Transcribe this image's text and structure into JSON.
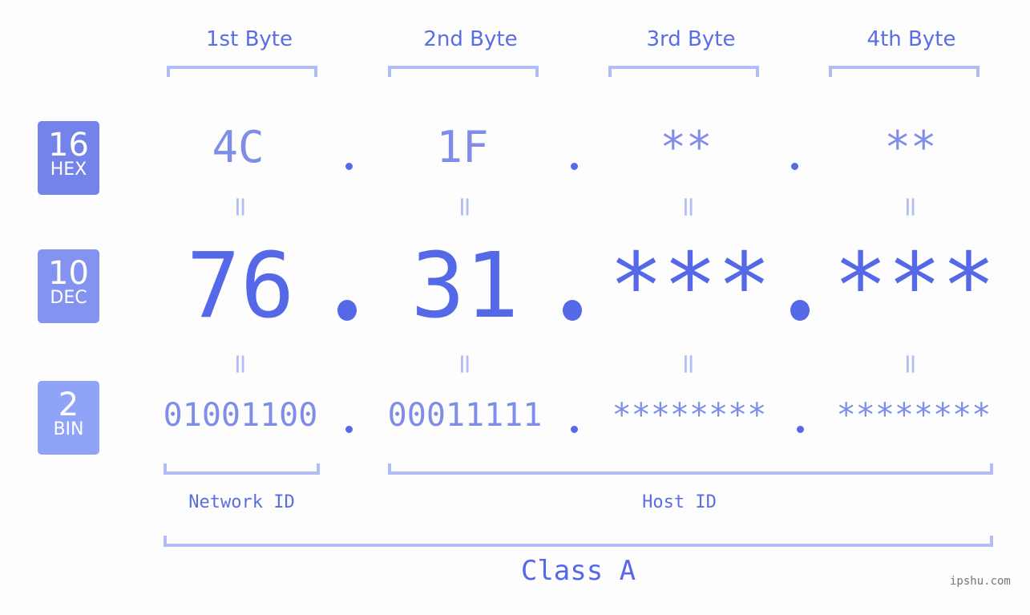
{
  "bytes": [
    {
      "label": "1st Byte",
      "hex": "4C",
      "dec": "76",
      "bin": "01001100"
    },
    {
      "label": "2nd Byte",
      "hex": "1F",
      "dec": "31",
      "bin": "00011111"
    },
    {
      "label": "3rd Byte",
      "hex": "**",
      "dec": "***",
      "bin": "********"
    },
    {
      "label": "4th Byte",
      "hex": "**",
      "dec": "***",
      "bin": "********"
    }
  ],
  "badges": {
    "hex": {
      "num": "16",
      "label": "HEX",
      "color": "#7383ea"
    },
    "dec": {
      "num": "10",
      "label": "DEC",
      "color": "#8493ef"
    },
    "bin": {
      "num": "2",
      "label": "BIN",
      "color": "#8fa4f6"
    }
  },
  "equals_symbol": "=",
  "sections": {
    "network": "Network ID",
    "host": "Host ID",
    "class": "Class A"
  },
  "watermark": "ipshu.com",
  "colors": {
    "accent": "#5468e8",
    "light_accent": "#7f8ce8",
    "bracket": "#b3bdf5",
    "background": "#fcfdfc"
  }
}
